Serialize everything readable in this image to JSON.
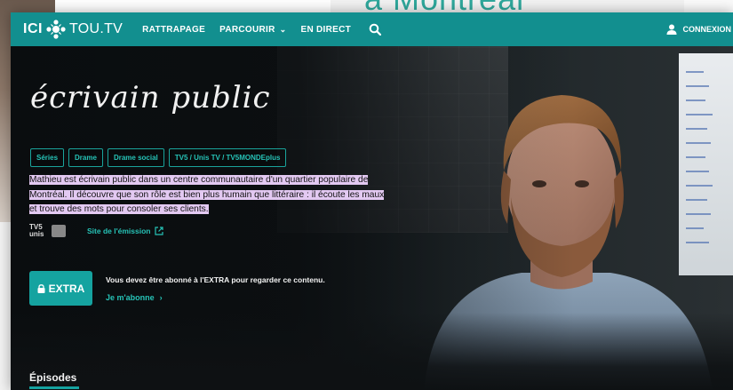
{
  "background": {
    "headline_fragment": "à Montréal"
  },
  "navbar": {
    "logo_ici": "ICI",
    "logo_toutv": "TOU.TV",
    "links": [
      "RATTRAPAGE",
      "PARCOURIR",
      "EN DIRECT"
    ],
    "parcourir_has_dropdown": true,
    "connexion": "CONNEXION",
    "bg_color": "#128f8f"
  },
  "hero": {
    "title": "écrivain public",
    "tags": [
      "Séries",
      "Drame",
      "Drame social",
      "TV5 / Unis TV / TV5MONDEplus"
    ],
    "synopsis_lines": [
      "Mathieu est écrivain public dans un centre communautaire d'un quartier populaire de",
      "Montréal. Il découvre que son rôle est bien plus humain que littéraire : il écoute les maux",
      "et trouve des mots pour consoler ses clients."
    ],
    "broadcaster_logo_text": "TV5 unis",
    "site_link": "Site de l'émission",
    "extra_button": "EXTRA",
    "subscribe_text": "Vous devez être abonné à l'EXTRA pour regarder ce contenu.",
    "subscribe_link": "Je m'abonne",
    "accent_color": "#15a3a0",
    "highlight_color": "#e3c9f2"
  },
  "episodes": {
    "title": "Épisodes"
  }
}
